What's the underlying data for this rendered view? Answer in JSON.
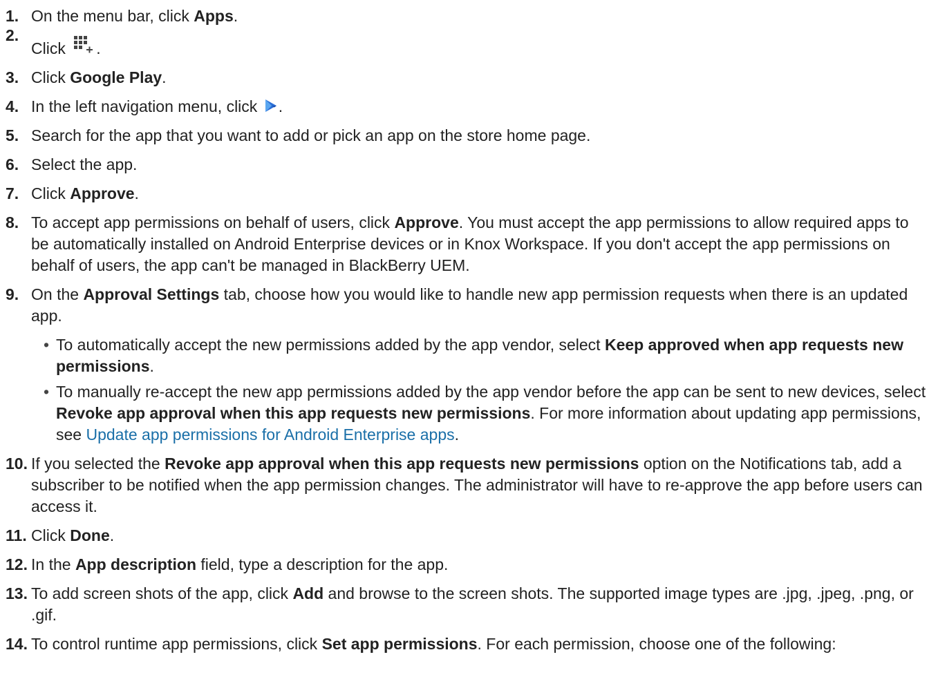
{
  "steps": [
    {
      "num": "1.",
      "parts": [
        {
          "t": "On the menu bar, click "
        },
        {
          "t": "Apps",
          "b": true
        },
        {
          "t": "."
        }
      ]
    },
    {
      "num": "2.",
      "parts": [
        {
          "t": "Click "
        },
        {
          "icon": "grid-add-icon"
        },
        {
          "t": "."
        }
      ]
    },
    {
      "num": "3.",
      "parts": [
        {
          "t": "Click "
        },
        {
          "t": "Google Play",
          "b": true
        },
        {
          "t": "."
        }
      ]
    },
    {
      "num": "4.",
      "parts": [
        {
          "t": "In the left navigation menu, click "
        },
        {
          "icon": "google-play-icon"
        },
        {
          "t": "."
        }
      ]
    },
    {
      "num": "5.",
      "parts": [
        {
          "t": "Search for the app that you want to add or pick an app on the store home page."
        }
      ]
    },
    {
      "num": "6.",
      "parts": [
        {
          "t": "Select the app."
        }
      ]
    },
    {
      "num": "7.",
      "parts": [
        {
          "t": "Click "
        },
        {
          "t": "Approve",
          "b": true
        },
        {
          "t": "."
        }
      ]
    },
    {
      "num": "8.",
      "parts": [
        {
          "t": "To accept app permissions on behalf of users, click "
        },
        {
          "t": "Approve",
          "b": true
        },
        {
          "t": ". You must accept the app permissions to allow required apps to be automatically installed on Android Enterprise devices or in Knox Workspace. If you don't accept the app permissions on behalf of users, the app can't be managed in BlackBerry UEM."
        }
      ]
    },
    {
      "num": "9.",
      "parts": [
        {
          "t": "On the "
        },
        {
          "t": "Approval Settings",
          "b": true
        },
        {
          "t": " tab, choose how you would like to handle new app permission requests when there is an updated app."
        }
      ],
      "sub": [
        {
          "parts": [
            {
              "t": "To automatically accept the new permissions added by the app vendor, select "
            },
            {
              "t": "Keep approved when app requests new permissions",
              "b": true
            },
            {
              "t": "."
            }
          ]
        },
        {
          "parts": [
            {
              "t": "To manually re-accept the new app permissions added by the app vendor before the app can be sent to new devices, select "
            },
            {
              "t": "Revoke app approval when this app requests new permissions",
              "b": true
            },
            {
              "t": ". For more information about updating app permissions, see "
            },
            {
              "t": "Update app permissions for Android Enterprise apps",
              "link": true
            },
            {
              "t": "."
            }
          ]
        }
      ]
    },
    {
      "num": "10.",
      "parts": [
        {
          "t": "If you selected the "
        },
        {
          "t": "Revoke app approval when this app requests new permissions",
          "b": true
        },
        {
          "t": " option on the Notifications tab, add a subscriber to be notified when the app permission changes. The administrator will have to re-approve the app before users can access it."
        }
      ]
    },
    {
      "num": "11.",
      "parts": [
        {
          "t": "Click "
        },
        {
          "t": "Done",
          "b": true
        },
        {
          "t": "."
        }
      ]
    },
    {
      "num": "12.",
      "parts": [
        {
          "t": "In the "
        },
        {
          "t": "App description",
          "b": true
        },
        {
          "t": " field, type a description for the app."
        }
      ]
    },
    {
      "num": "13.",
      "parts": [
        {
          "t": "To add screen shots of the app, click "
        },
        {
          "t": "Add",
          "b": true
        },
        {
          "t": " and browse to the screen shots. The supported image types are .jpg, .jpeg, .png, or .gif."
        }
      ]
    },
    {
      "num": "14.",
      "parts": [
        {
          "t": "To control runtime app permissions, click "
        },
        {
          "t": "Set app permissions",
          "b": true
        },
        {
          "t": ". For each permission, choose one of the following:"
        }
      ]
    }
  ],
  "bullet_char": "•",
  "colors": {
    "text": "#222222",
    "link": "#1a6fa8",
    "play_icon": "#2b6fd6",
    "grid_icon": "#444444"
  }
}
